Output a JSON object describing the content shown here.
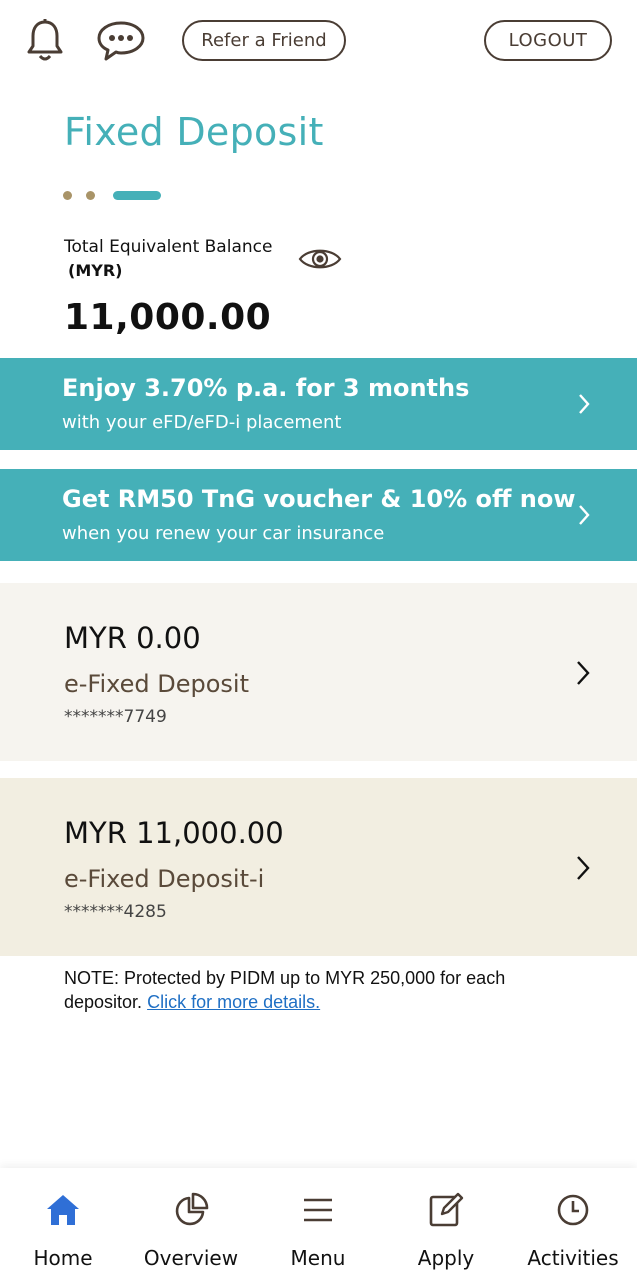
{
  "header": {
    "notifications_icon": "bell-icon",
    "messages_icon": "chat-bubble-icon",
    "refer_label": "Refer a Friend",
    "logout_label": "LOGOUT"
  },
  "page": {
    "title": "Fixed Deposit",
    "pager": {
      "total": 3,
      "active": 3
    }
  },
  "balance": {
    "label": "Total Equivalent Balance",
    "currency": "(MYR)",
    "amount": "11,000.00",
    "visibility_icon": "eye-icon"
  },
  "promos": [
    {
      "title": "Enjoy 3.70% p.a. for 3 months",
      "subtitle": "with your eFD/eFD-i placement"
    },
    {
      "title": "Get RM50 TnG voucher & 10% off now",
      "subtitle": "when you renew your car insurance"
    }
  ],
  "accounts": [
    {
      "amount": "MYR 0.00",
      "name": "e-Fixed Deposit",
      "number": "*******7749"
    },
    {
      "amount": "MYR 11,000.00",
      "name": "e-Fixed Deposit-i",
      "number": "*******4285"
    }
  ],
  "note": {
    "text": "NOTE: Protected by PIDM up to MYR 250,000 for each depositor.",
    "link": "Click for more details."
  },
  "nav": {
    "items": [
      {
        "label": "Home",
        "icon": "home-icon",
        "active": true
      },
      {
        "label": "Overview",
        "icon": "pie-chart-icon",
        "active": false
      },
      {
        "label": "Menu",
        "icon": "hamburger-icon",
        "active": false
      },
      {
        "label": "Apply",
        "icon": "edit-form-icon",
        "active": false
      },
      {
        "label": "Activities",
        "icon": "clock-icon",
        "active": false
      }
    ]
  },
  "colors": {
    "brand_teal": "#45b0b8",
    "brand_brown": "#4a3d34",
    "pager_dot": "#a99468",
    "nav_active": "#2f6fd6",
    "card_light": "#f6f4ef",
    "card_beige": "#f2eee1",
    "link": "#1f6fc4"
  }
}
